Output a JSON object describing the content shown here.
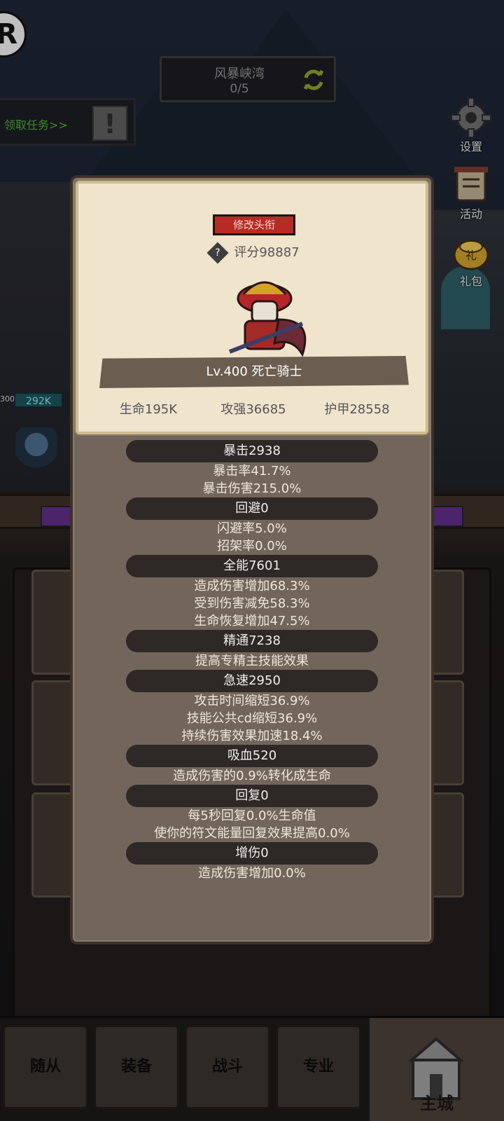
{
  "map": {
    "name": "风暴峡湾",
    "progress": "0/5"
  },
  "quest": {
    "label": "领取任务>>",
    "alert": "!"
  },
  "logo": {
    "letter": "R"
  },
  "side_buttons": [
    {
      "label": "设置",
      "icon": "gear-icon"
    },
    {
      "label": "活动",
      "icon": "scroll-icon"
    },
    {
      "label": "礼包",
      "icon": "gift-pot-icon"
    }
  ],
  "background": {
    "hp_small": "300",
    "hp_tag": "292K"
  },
  "dialog": {
    "title_button": "修改头衔",
    "rating_prefix": "评分",
    "rating_value": "98887",
    "hero_name": "Lv.400 死亡骑士",
    "core_stats": [
      "生命195K",
      "攻强36685",
      "护甲28558"
    ],
    "groups": [
      {
        "head": "暴击2938",
        "lines": [
          "暴击率41.7%",
          "暴击伤害215.0%"
        ]
      },
      {
        "head": "回避0",
        "lines": [
          "闪避率5.0%",
          "招架率0.0%"
        ]
      },
      {
        "head": "全能7601",
        "lines": [
          "造成伤害增加68.3%",
          "受到伤害减免58.3%",
          "生命恢复增加47.5%"
        ]
      },
      {
        "head": "精通7238",
        "lines": [
          "提高专精主技能效果"
        ]
      },
      {
        "head": "急速2950",
        "lines": [
          "攻击时间缩短36.9%",
          "技能公共cd缩短36.9%",
          "持续伤害效果加速18.4%"
        ]
      },
      {
        "head": "吸血520",
        "lines": [
          "造成伤害的0.9%转化成生命"
        ]
      },
      {
        "head": "回复0",
        "lines": [
          "每5秒回复0.0%生命值",
          "使你的符文能量回复效果提高0.0%"
        ]
      },
      {
        "head": "增伤0",
        "lines": [
          "造成伤害增加0.0%"
        ]
      }
    ]
  },
  "bottom_nav": [
    "随从",
    "装备",
    "战斗",
    "专业"
  ],
  "bottom_nav_active": "主城",
  "colors": {
    "title_button": "#b72a25",
    "card": "#efe4cc",
    "dialog": "#72665a",
    "quest_text": "#4ba73a"
  }
}
